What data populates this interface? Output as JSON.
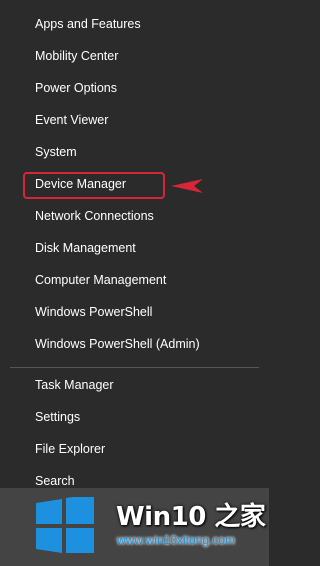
{
  "menu": {
    "items": [
      {
        "label": "Apps and Features"
      },
      {
        "label": "Mobility Center"
      },
      {
        "label": "Power Options"
      },
      {
        "label": "Event Viewer"
      },
      {
        "label": "System"
      },
      {
        "label": "Device Manager"
      },
      {
        "label": "Network Connections"
      },
      {
        "label": "Disk Management"
      },
      {
        "label": "Computer Management"
      },
      {
        "label": "Windows PowerShell"
      },
      {
        "label": "Windows PowerShell (Admin)"
      },
      {
        "label": "Task Manager"
      },
      {
        "label": "Settings"
      },
      {
        "label": "File Explorer"
      },
      {
        "label": "Search"
      }
    ]
  },
  "annotation": {
    "highlight_color": "#d72638",
    "pointer_icon": "left-arrow-pointer-icon"
  },
  "watermark": {
    "title": "Win10 之家",
    "url": "www.win10xitong.com",
    "logo_icon": "windows-logo-icon",
    "logo_color": "#1e90e0"
  },
  "colors": {
    "menu_background": "#2b2b2b",
    "text": "#ffffff",
    "divider": "#555555"
  }
}
